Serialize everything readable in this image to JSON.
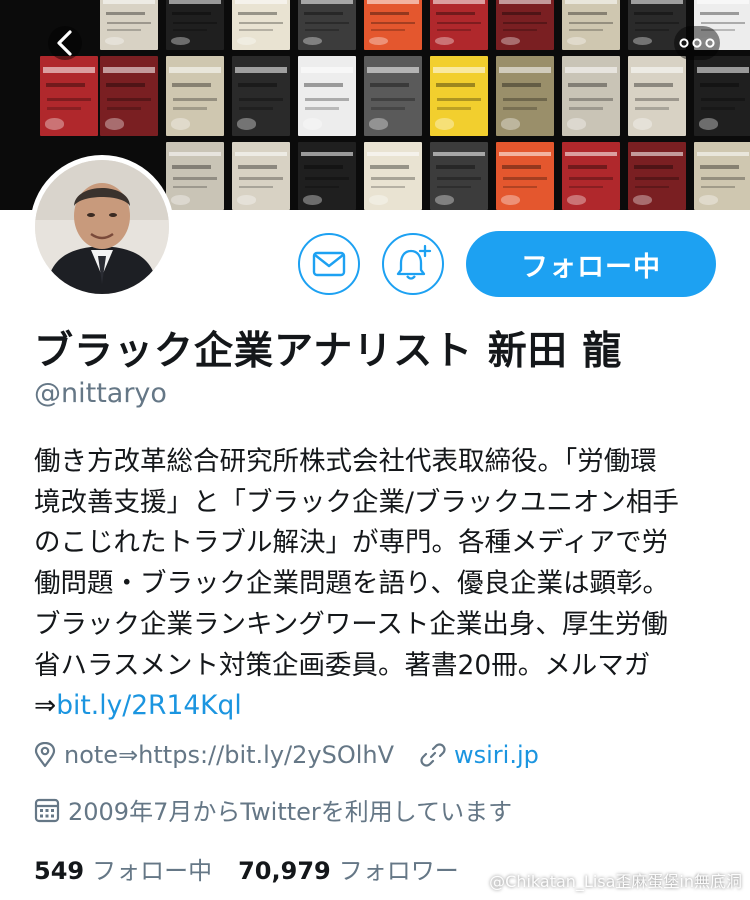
{
  "profile": {
    "name": "ブラック企業アナリスト 新田 龍",
    "handle": "@nittaryo",
    "bio_lines": [
      "働き方改革総合研究所株式会社代表取締役。「労働環",
      "境改善支援」と「ブラック企業/ブラックユニオン相手",
      "のこじれたトラブル解決」が専門。各種メディアで労",
      "働問題・ブラック企業問題を語り、優良企業は顕彰。",
      "ブラック企業ランキングワースト企業出身、厚生労働",
      "省ハラスメント対策企画委員。著書20冊。メルマガ"
    ],
    "bio_link_prefix": "⇒",
    "bio_link": "bit.ly/2R14Kql",
    "location": "note⇒https://bit.ly/2ySOlhV",
    "website": "wsiri.jp",
    "joined": "2009年7月からTwitterを利用しています"
  },
  "stats": {
    "following_count": "549",
    "following_label": "フォロー中",
    "followers_count": "70,979",
    "followers_label": "フォロワー"
  },
  "actions": {
    "follow_label": "フォロー中"
  },
  "icons": {
    "back": "chevron-left-icon",
    "more": "more-dots-icon",
    "mail": "mail-icon",
    "notify": "bell-plus-icon",
    "location": "location-pin-icon",
    "link": "link-icon",
    "calendar": "calendar-icon"
  },
  "colors": {
    "accent": "#1da1f2",
    "link": "#1b95e0",
    "muted": "#657786",
    "text": "#14171a"
  },
  "watermark": "@Chikatan_Lisa歪麻蛋堡in無底洞"
}
